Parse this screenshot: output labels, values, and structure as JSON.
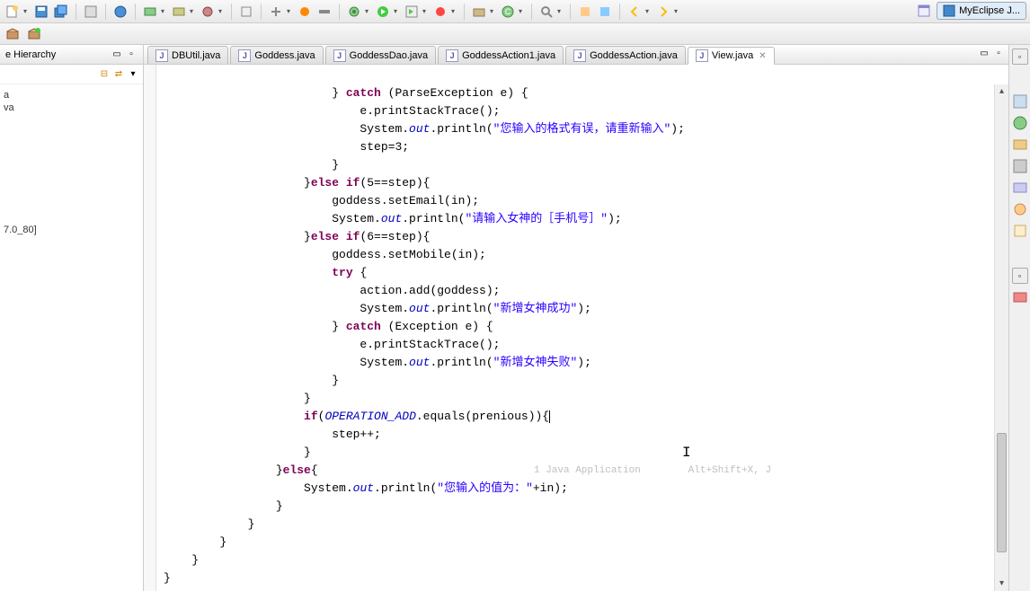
{
  "perspective": {
    "label": "MyEclipse J..."
  },
  "left_panel": {
    "title": "e Hierarchy",
    "items": [
      "a",
      "va",
      "7.0_80]"
    ]
  },
  "tabs": [
    {
      "label": "DBUtil.java",
      "active": false
    },
    {
      "label": "Goddess.java",
      "active": false
    },
    {
      "label": "GoddessDao.java",
      "active": false
    },
    {
      "label": "GoddessAction1.java",
      "active": false
    },
    {
      "label": "GoddessAction.java",
      "active": false
    },
    {
      "label": "View.java",
      "active": true
    }
  ],
  "code": {
    "l01_a": "                        } ",
    "l01_kw": "catch",
    "l01_b": " (ParseException e) {",
    "l02": "                            e.printStackTrace();",
    "l03_a": "                            System.",
    "l03_f": "out",
    "l03_b": ".println(",
    "l03_s": "\"您输入的格式有误，请重新输入\"",
    "l03_c": ");",
    "l04": "                            step=3;",
    "l05": "                        }",
    "l06_a": "                    }",
    "l06_kw": "else if",
    "l06_b": "(5==step){",
    "l07": "                        goddess.setEmail(in);",
    "l08_a": "                        System.",
    "l08_f": "out",
    "l08_b": ".println(",
    "l08_s": "\"请输入女神的［手机号］\"",
    "l08_c": ");",
    "l09_a": "                    }",
    "l09_kw": "else if",
    "l09_b": "(6==step){",
    "l10": "                        goddess.setMobile(in);",
    "l11_a": "                        ",
    "l11_kw": "try",
    "l11_b": " {",
    "l12": "                            action.add(goddess);",
    "l13_a": "                            System.",
    "l13_f": "out",
    "l13_b": ".println(",
    "l13_s": "\"新增女神成功\"",
    "l13_c": ");",
    "l14_a": "                        } ",
    "l14_kw": "catch",
    "l14_b": " (Exception e) {",
    "l15": "                            e.printStackTrace();",
    "l16_a": "                            System.",
    "l16_f": "out",
    "l16_b": ".println(",
    "l16_s": "\"新增女神失败\"",
    "l16_c": ");",
    "l17": "                        }",
    "l18": "                    }",
    "l19_a": "                    ",
    "l19_kw": "if",
    "l19_b": "(",
    "l19_f": "OPERATION_ADD",
    "l19_c": ".equals(prenious)){",
    "l20": "                        step++;",
    "l21": "                    }",
    "l22_a": "                }",
    "l22_kw": "else",
    "l22_b": "{",
    "l23_a": "                    System.",
    "l23_f": "out",
    "l23_b": ".println(",
    "l23_s": "\"您输入的值为：\"",
    "l23_c": "+in);",
    "l24": "                }",
    "l25": "            }",
    "l26": "        }",
    "l27": "    }",
    "l28": "}",
    "hint_a": "1 Java Application",
    "hint_b": "Alt+Shift+X, J"
  },
  "colors": {
    "keyword": "#7f0055",
    "string": "#2a00ff",
    "field": "#0000c0"
  }
}
